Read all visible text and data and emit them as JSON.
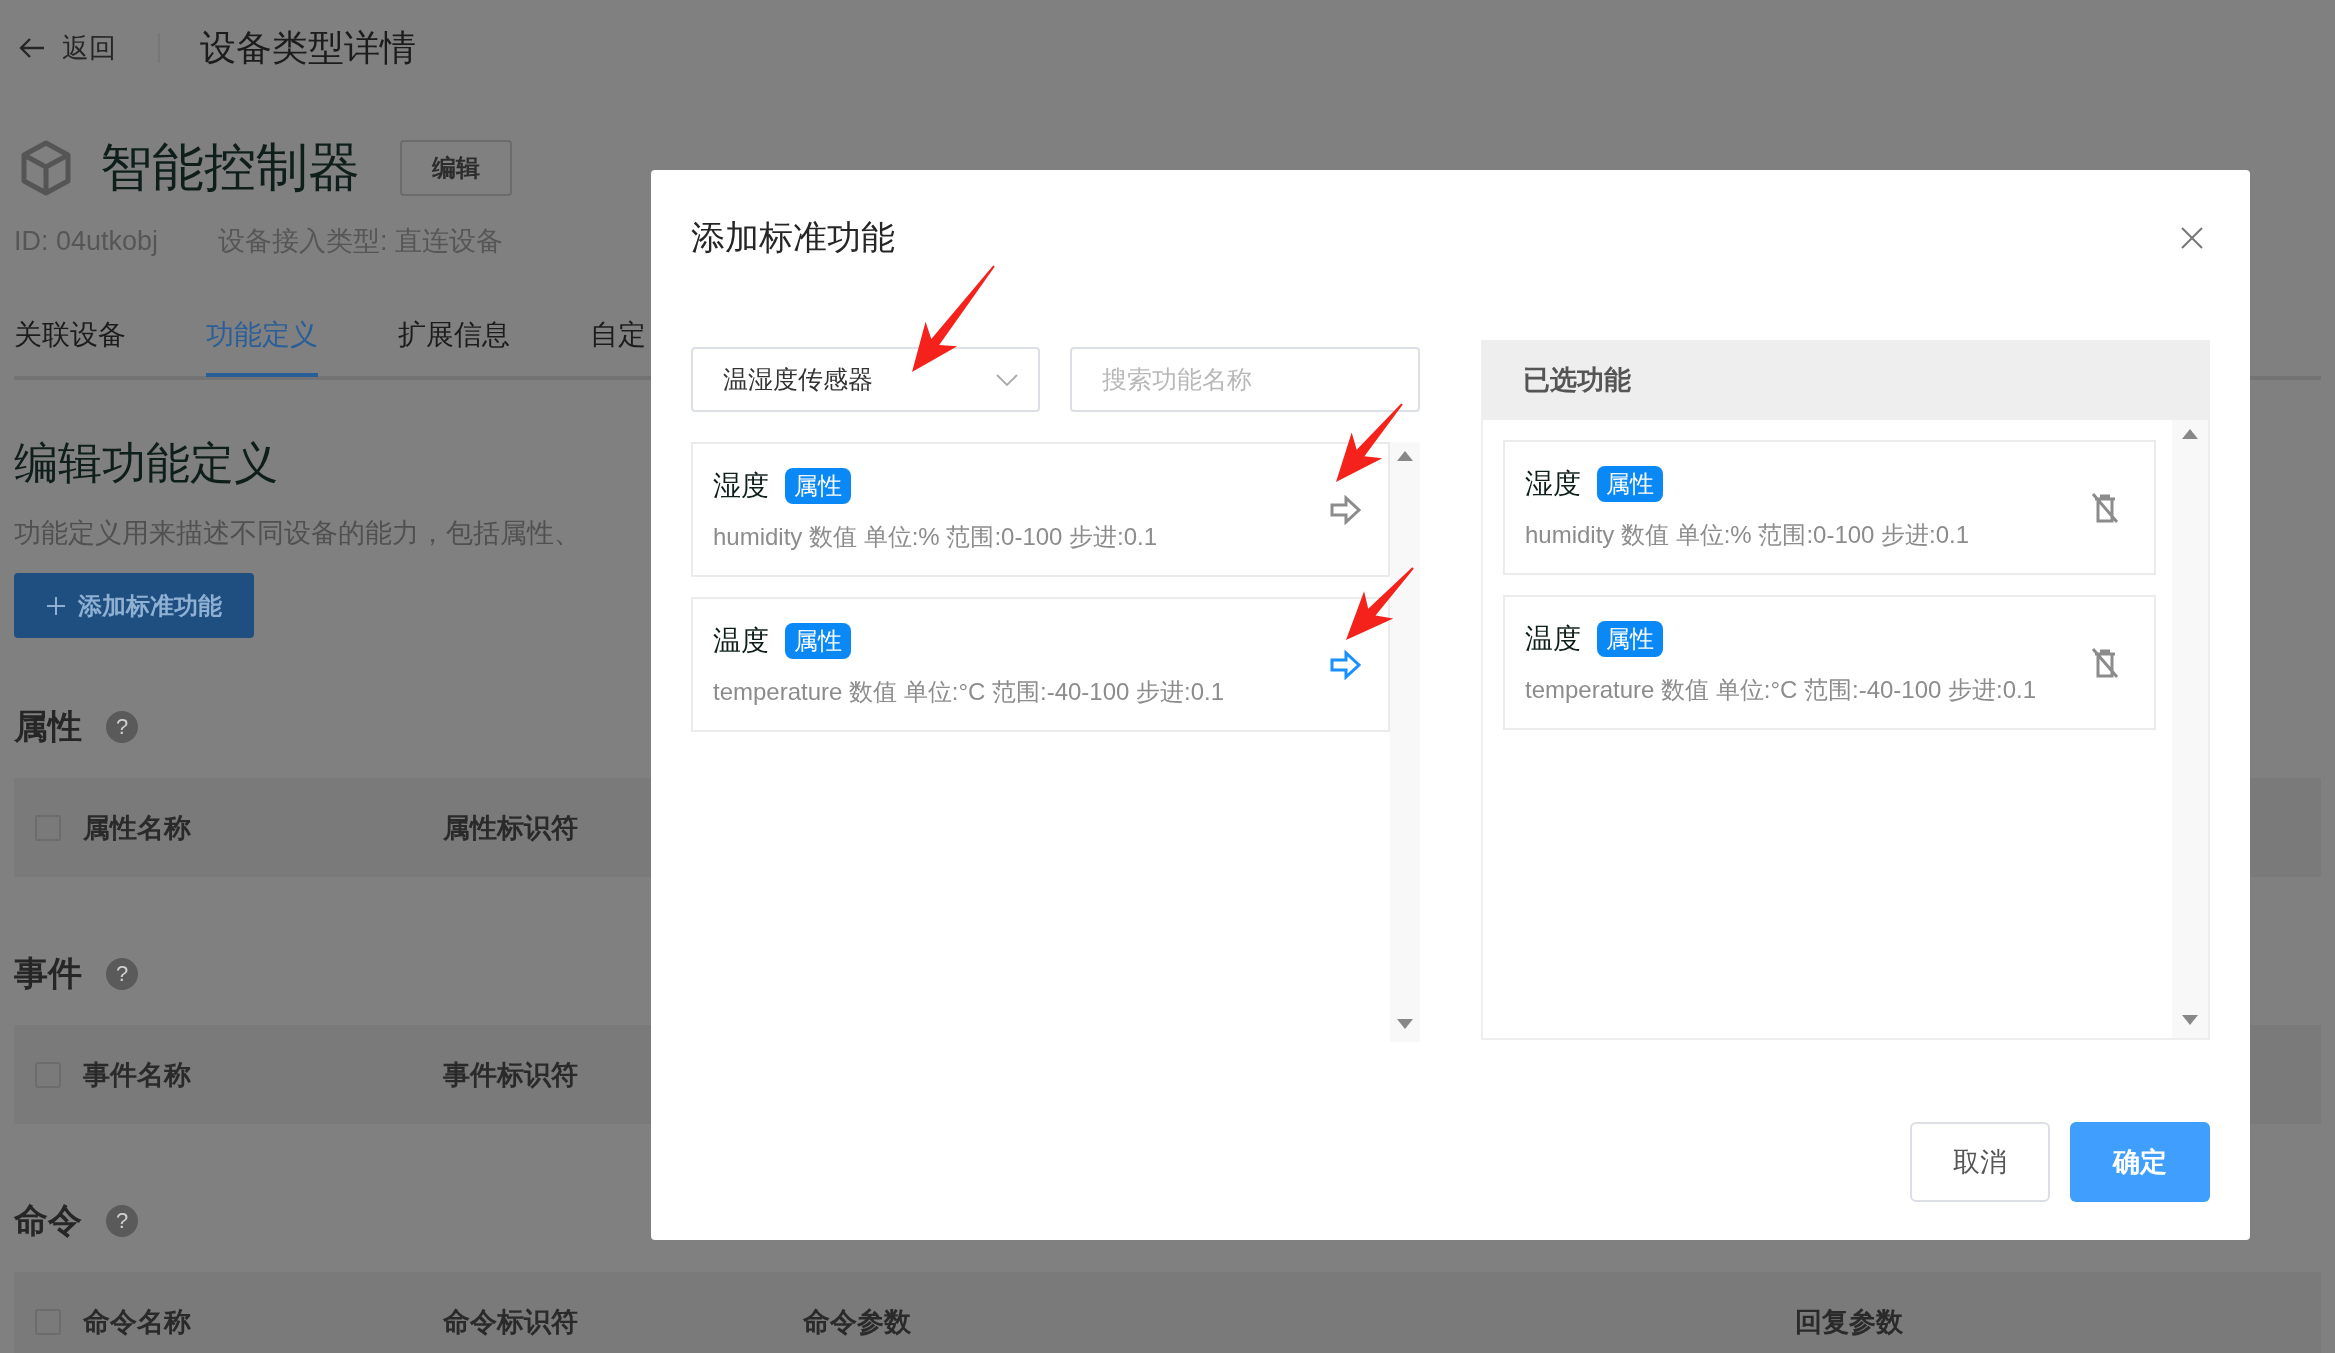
{
  "header": {
    "back": "返回",
    "title": "设备类型详情"
  },
  "device": {
    "name": "智能控制器",
    "edit_button": "编辑",
    "id": "ID: 04utkobj",
    "access_type": "设备接入类型: 直连设备"
  },
  "tabs": [
    {
      "label": "关联设备",
      "selected": false
    },
    {
      "label": "功能定义",
      "selected": true
    },
    {
      "label": "扩展信息",
      "selected": false
    },
    {
      "label": "自定",
      "selected": false
    }
  ],
  "section": {
    "title": "编辑功能定义",
    "description": "功能定义用来描述不同设备的能力，包括属性、",
    "add_button": "添加标准功能"
  },
  "tables": [
    {
      "title": "属性",
      "help": "?",
      "checked": false,
      "columns": [
        "属性名称",
        "属性标识符"
      ]
    },
    {
      "title": "事件",
      "help": "?",
      "checked": false,
      "columns": [
        "事件名称",
        "事件标识符"
      ]
    },
    {
      "title": "命令",
      "help": "?",
      "checked": false,
      "columns": [
        "命令名称",
        "命令标识符",
        "命令参数",
        "回复参数"
      ]
    }
  ],
  "dialog": {
    "title": "添加标准功能",
    "category": "温湿度传感器",
    "search": {
      "placeholder": "搜索功能名称"
    },
    "available": [
      {
        "name": "湿度",
        "tag": "属性",
        "detail": "humidity 数值 单位:% 范围:0-100 步进:0.1",
        "active": false
      },
      {
        "name": "温度",
        "tag": "属性",
        "detail": "temperature 数值 单位:°C 范围:-40-100 步进:0.1",
        "active": true
      }
    ],
    "selected_title": "已选功能",
    "selected": [
      {
        "name": "湿度",
        "tag": "属性",
        "detail": "humidity 数值 单位:% 范围:0-100 步进:0.1"
      },
      {
        "name": "温度",
        "tag": "属性",
        "detail": "temperature 数值 单位:°C 范围:-40-100 步进:0.1"
      }
    ],
    "buttons": {
      "cancel": "取消",
      "confirm": "确定"
    }
  }
}
